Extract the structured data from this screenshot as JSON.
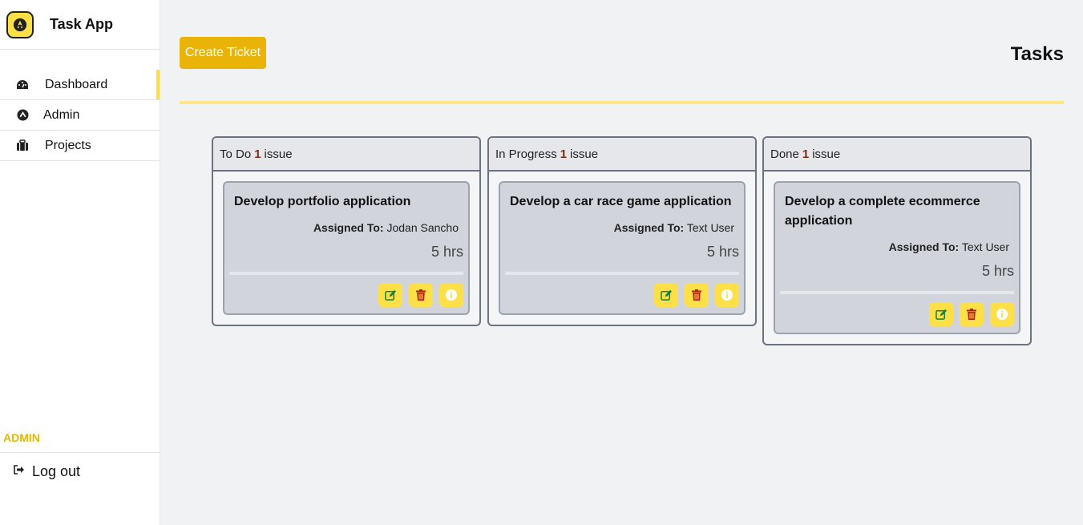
{
  "app": {
    "title": "Task App"
  },
  "sidebar": {
    "items": [
      {
        "label": "Dashboard",
        "icon": "dashboard-icon"
      },
      {
        "label": "Admin",
        "icon": "admin-icon"
      },
      {
        "label": "Projects",
        "icon": "briefcase-icon"
      }
    ],
    "role": "ADMIN",
    "logout": "Log out"
  },
  "main": {
    "create_label": "Create Ticket",
    "title": "Tasks",
    "columns": [
      {
        "name": "To Do",
        "count": "1",
        "unit": "issue",
        "card": {
          "title": "Develop portfolio application",
          "assigned_label": "Assigned To:",
          "assignee": "Jodan Sancho",
          "hours": "5 hrs"
        }
      },
      {
        "name": "In Progress",
        "count": "1",
        "unit": "issue",
        "card": {
          "title": "Develop a car race game application",
          "assigned_label": "Assigned To:",
          "assignee": "Text User",
          "hours": "5 hrs"
        }
      },
      {
        "name": "Done",
        "count": "1",
        "unit": "issue",
        "card": {
          "title": "Develop a complete ecommerce application",
          "assigned_label": "Assigned To:",
          "assignee": "Text User",
          "hours": "5 hrs"
        }
      }
    ]
  },
  "colors": {
    "accent": "#eab308",
    "highlight": "#fde047",
    "edit": "#15803d",
    "delete": "#b91c1c"
  }
}
